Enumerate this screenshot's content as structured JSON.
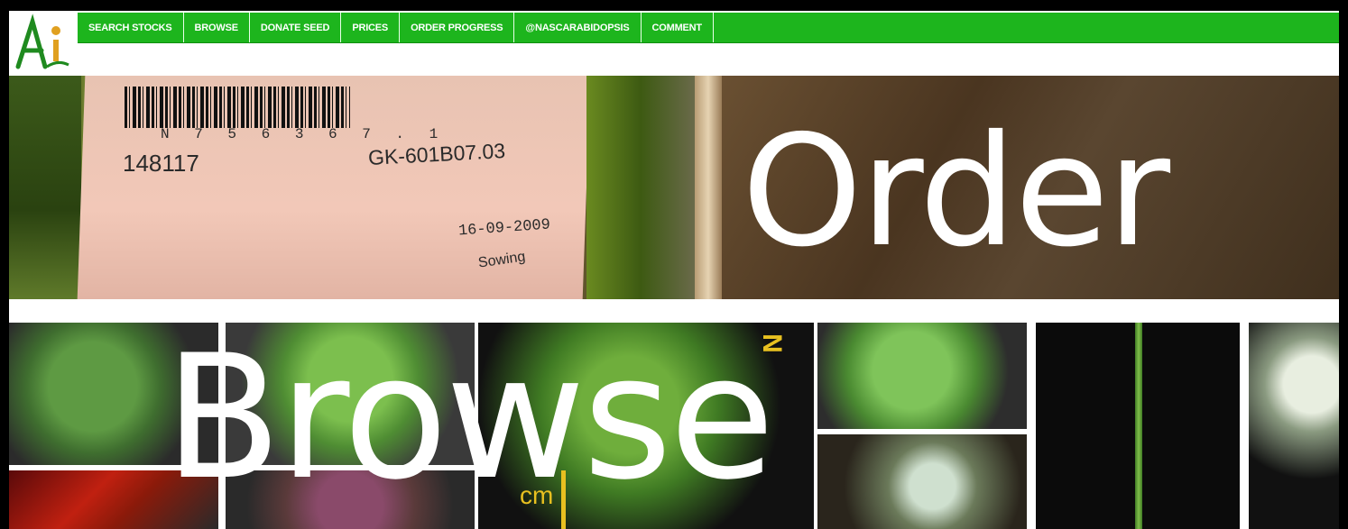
{
  "logo": {
    "name": "Ai logo",
    "letter": "A"
  },
  "nav": {
    "items": [
      {
        "label": "SEARCH STOCKS"
      },
      {
        "label": "BROWSE"
      },
      {
        "label": "DONATE SEED"
      },
      {
        "label": "PRICES"
      },
      {
        "label": "ORDER PROGRESS"
      },
      {
        "label": "@NASCARABIDOPSIS"
      },
      {
        "label": "COMMENT"
      }
    ],
    "bar_color": "#1db51d"
  },
  "order_banner": {
    "title": "Order",
    "label": {
      "barcode_number": "N 7 5 6 3 6 7 . 1",
      "stock_number": "148117",
      "gk_code": "GK-601B07.03",
      "date": "16-09-2009",
      "note": "Sowing"
    }
  },
  "browse_banner": {
    "title": "Browse",
    "overlay_text_1": "N",
    "overlay_text_2": "cm"
  }
}
